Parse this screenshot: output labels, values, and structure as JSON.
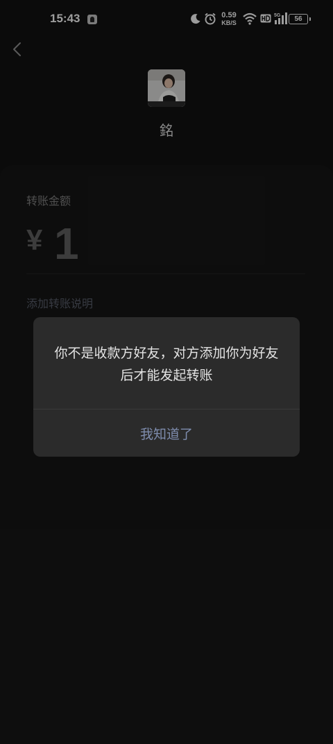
{
  "status_bar": {
    "time": "15:43",
    "network_speed": "0.59",
    "network_unit": "KB/S",
    "battery": "56",
    "icons": [
      "notification-icon",
      "moon-icon",
      "alarm-icon",
      "wifi-icon",
      "hd-icon",
      "signal-5g-icon",
      "battery-icon"
    ]
  },
  "header": {
    "back_icon": "chevron-left-icon",
    "payee_name": "銘"
  },
  "transfer": {
    "amount_label": "转账金额",
    "currency_symbol": "¥",
    "amount": "1",
    "add_remark": "添加转账说明"
  },
  "dialog": {
    "message": "你不是收款方好友，对方添加你为好友后才能发起转账",
    "confirm_label": "我知道了"
  },
  "colors": {
    "background": "#111111",
    "dialog": "#2b2b2b",
    "link": "#7e8cad"
  }
}
